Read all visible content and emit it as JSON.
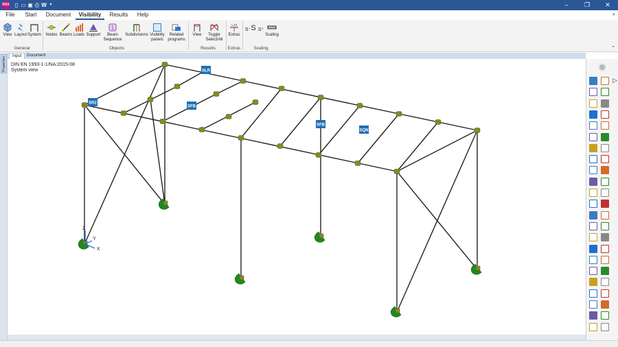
{
  "window": {
    "app_icon": "RSX",
    "quick_access": [
      "new-icon",
      "open-icon",
      "save-icon",
      "print-icon",
      "W",
      "dropdown-icon"
    ],
    "controls": [
      "minimize-icon",
      "restore-icon",
      "close-icon"
    ]
  },
  "menu": {
    "items": [
      "File",
      "Start",
      "Document",
      "Visibility",
      "Results",
      "Help"
    ],
    "active": "Visibility"
  },
  "ribbon": {
    "groups": {
      "general": "General",
      "objects": "Objects",
      "results": "Results",
      "extras": "Extras",
      "scaling": "Scaling"
    },
    "buttons": {
      "view": "View",
      "layout": "Layout",
      "system": "System",
      "nodes": "Nodes",
      "beams": "Beams",
      "loads": "Loads",
      "support": "Support",
      "beam_sequence_1": "Beam",
      "beam_sequence_2": "Sequence",
      "subdivisions": "Subdivisions",
      "visibility_panels_1": "Visibility",
      "visibility_panels_2": "panels",
      "related_programs_1": "Related",
      "related_programs_2": "programs",
      "results_view": "View",
      "toggle_1": "Toggle",
      "toggle_2": "Select/All",
      "extras": "Extras",
      "scaling": "Scaling",
      "scale_small": "S⁻",
      "scale_mid": "S",
      "scale_plus": "S⁺",
      "extras_icon_text": "1.22"
    }
  },
  "tabs": [
    "Input",
    "Document"
  ],
  "active_tab": "Input",
  "side_tab": "Properties",
  "viewport": {
    "line1": "DIN EN 1993-1-1/NA:2015-08",
    "line2": "System view",
    "axis_x": "X",
    "axis_y": "Y",
    "axis_z": "Z",
    "labels": [
      "SR2",
      "SLR",
      "SFB",
      "SFB",
      "SQN"
    ]
  },
  "colors": {
    "titlebar": "#2b5797",
    "node": "#8a8a1a",
    "support": "#1f8a1f",
    "label_bg": "#1f6fb5",
    "beam": "#222222"
  }
}
